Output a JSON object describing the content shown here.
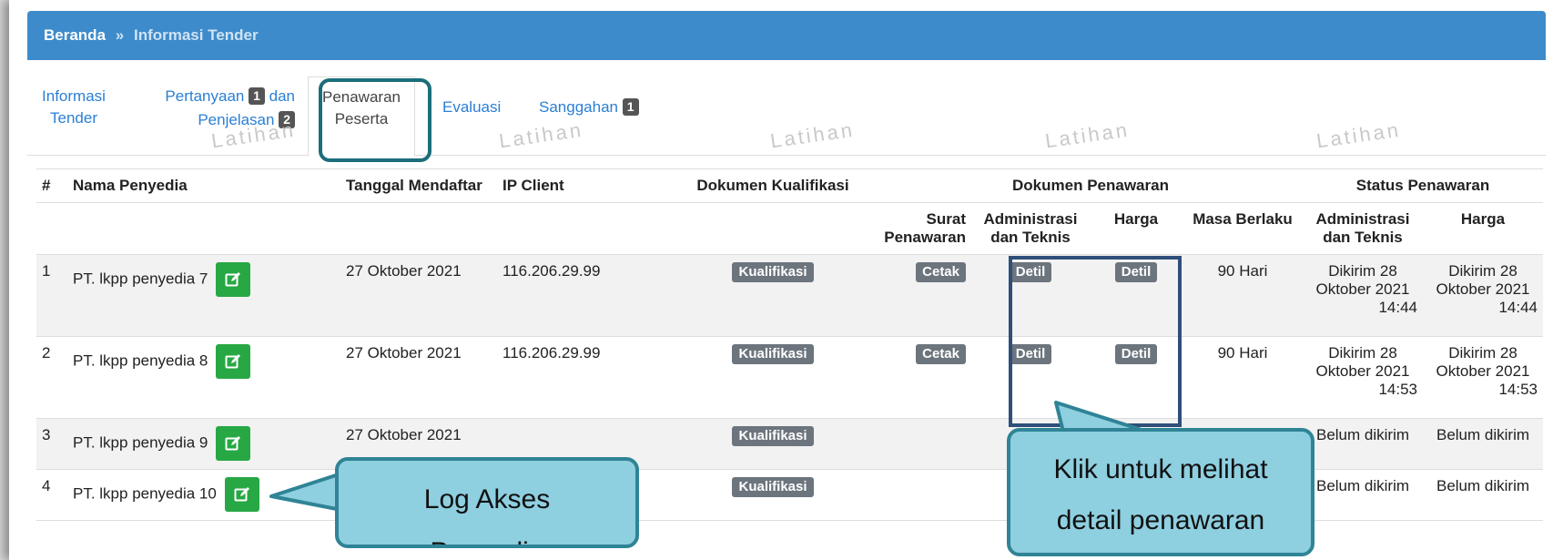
{
  "breadcrumb": {
    "home": "Beranda",
    "separator": "»",
    "current": "Informasi Tender"
  },
  "tabs": {
    "informasi_line1": "Informasi",
    "informasi_line2": "Tender",
    "pertanyaan_line1": "Pertanyaan",
    "pertanyaan_badge": "1",
    "pertanyaan_dan": "dan",
    "penjelasan": "Penjelasan",
    "penjelasan_badge": "2",
    "penawaran_line1": "Penawaran",
    "penawaran_line2": "Peserta",
    "evaluasi": "Evaluasi",
    "sanggahan": "Sanggahan",
    "sanggahan_badge": "1"
  },
  "watermark": "Latihan",
  "table": {
    "headers": {
      "no": "#",
      "nama": "Nama Penyedia",
      "tanggal": "Tanggal Mendaftar",
      "ip": "IP Client",
      "kualifikasi": "Dokumen Kualifikasi",
      "penawaran": "Dokumen Penawaran",
      "status": "Status Penawaran",
      "surat_1": "Surat",
      "surat_2": "Penawaran",
      "admin_1": "Administrasi",
      "admin_2": "dan Teknis",
      "harga": "Harga",
      "masa": "Masa Berlaku",
      "st_admin_1": "Administrasi",
      "st_admin_2": "dan Teknis",
      "st_harga": "Harga"
    },
    "rows": [
      {
        "no": "1",
        "nama": "PT. lkpp penyedia 7",
        "tanggal": "27 Oktober 2021",
        "ip": "116.206.29.99",
        "kualifikasi": "Kualifikasi",
        "surat": "Cetak",
        "admin": "Detil",
        "harga": "Detil",
        "masa": "90 Hari",
        "st_admin_1": "Dikirim 28",
        "st_admin_2": "Oktober 2021",
        "st_admin_3": "14:44",
        "st_harga_1": "Dikirim 28",
        "st_harga_2": "Oktober 2021",
        "st_harga_3": "14:44"
      },
      {
        "no": "2",
        "nama": "PT. lkpp penyedia 8",
        "tanggal": "27 Oktober 2021",
        "ip": "116.206.29.99",
        "kualifikasi": "Kualifikasi",
        "surat": "Cetak",
        "admin": "Detil",
        "harga": "Detil",
        "masa": "90 Hari",
        "st_admin_1": "Dikirim 28",
        "st_admin_2": "Oktober 2021",
        "st_admin_3": "14:53",
        "st_harga_1": "Dikirim 28",
        "st_harga_2": "Oktober 2021",
        "st_harga_3": "14:53"
      },
      {
        "no": "3",
        "nama": "PT. lkpp penyedia 9",
        "tanggal": "27 Oktober 2021",
        "kualifikasi": "Kualifikasi",
        "st_admin": "Belum dikirim",
        "st_harga": "Belum dikirim"
      },
      {
        "no": "4",
        "nama": "PT. lkpp penyedia 10",
        "kualifikasi": "Kualifikasi",
        "st_admin": "Belum dikirim",
        "st_harga": "Belum dikirim"
      }
    ]
  },
  "callouts": {
    "log_line1": "Log Akses",
    "log_line2": "Penyedia",
    "detail_line1": "Klik untuk melihat",
    "detail_line2": "detail penawaran"
  },
  "colors": {
    "header_blue": "#3d8bca",
    "link_blue": "#2a7fd4",
    "edit_green": "#27a844",
    "label_gray": "#6c757d",
    "callout_fill": "#8ecfe0",
    "callout_border": "#2f8496"
  }
}
